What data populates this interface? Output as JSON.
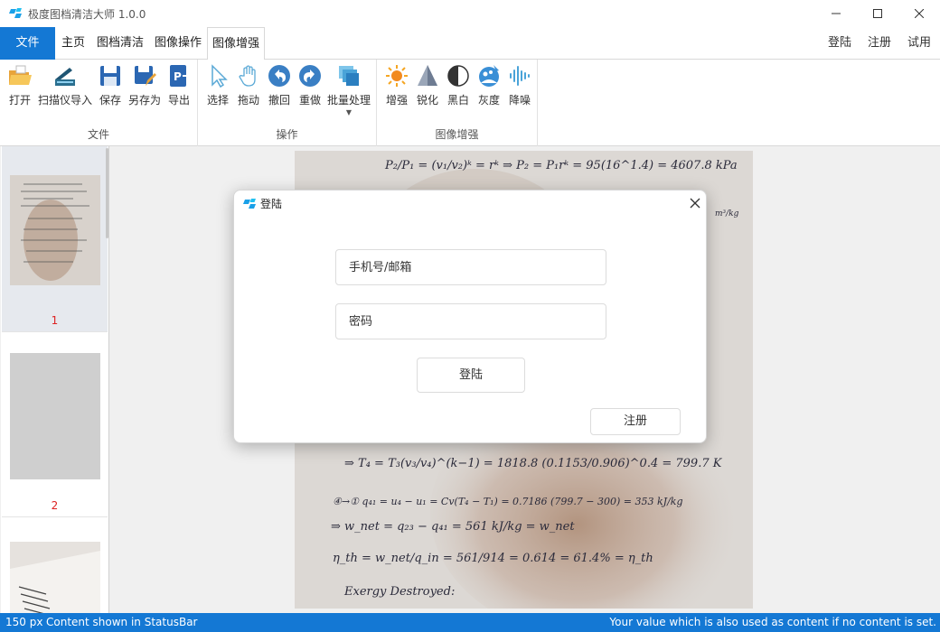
{
  "titlebar": {
    "title": "极度图档清洁大师 1.0.0",
    "minimize_icon": "minimize-icon",
    "maximize_icon": "maximize-icon",
    "close_icon": "close-icon"
  },
  "tabs": {
    "file": "文件",
    "items": [
      "主页",
      "图档清洁",
      "图像操作",
      "图像增强"
    ],
    "active": "图像增强",
    "right": [
      "登陆",
      "注册",
      "试用"
    ]
  },
  "ribbon": {
    "groups": [
      {
        "label": "文件",
        "buttons": [
          {
            "label": "打开",
            "icon": "folder-open-icon"
          },
          {
            "label": "扫描仪导入",
            "icon": "scanner-icon"
          },
          {
            "label": "保存",
            "icon": "save-icon"
          },
          {
            "label": "另存为",
            "icon": "save-as-icon"
          },
          {
            "label": "导出",
            "icon": "export-icon"
          }
        ]
      },
      {
        "label": "操作",
        "buttons": [
          {
            "label": "选择",
            "icon": "pointer-icon"
          },
          {
            "label": "拖动",
            "icon": "hand-icon"
          },
          {
            "label": "撤回",
            "icon": "undo-icon"
          },
          {
            "label": "重做",
            "icon": "redo-icon"
          },
          {
            "label": "批量处理",
            "icon": "batch-icon"
          }
        ]
      },
      {
        "label": "图像增强",
        "buttons": [
          {
            "label": "增强",
            "icon": "sun-icon"
          },
          {
            "label": "锐化",
            "icon": "triangle-icon"
          },
          {
            "label": "黑白",
            "icon": "contrast-icon"
          },
          {
            "label": "灰度",
            "icon": "grayscale-icon"
          },
          {
            "label": "降噪",
            "icon": "waveform-icon"
          }
        ]
      }
    ]
  },
  "thumbnails": [
    {
      "number": "1",
      "selected": true
    },
    {
      "number": "2",
      "selected": false
    },
    {
      "number": "",
      "selected": false
    }
  ],
  "dialog": {
    "title": "登陆",
    "phone_placeholder": "手机号/邮箱",
    "password_placeholder": "密码",
    "login_button": "登陆",
    "register_button": "注册"
  },
  "document": {
    "lines_top": [
      "P₂/P₁ = (v₁/v₂)ᵏ = rᵏ ⇒ P₂ = P₁rᵏ = 95(16^1.4) = 4607.8 kPa",
      "m³/kg"
    ],
    "lines_bottom": [
      "⇒ T₄ = T₃(v₃/v₄)^(k−1) = 1818.8 (0.1153/0.906)^0.4 = 799.7 K",
      "④→① q₄₁ = u₄ − u₁ = Cv(T₄ − T₁) = 0.7186 (799.7 − 300) = 353 kJ/kg",
      "⇒ w_net = q₂₃ − q₄₁ = 561 kJ/kg = w_net",
      "η_th = w_net/q_in = 561/914 = 0.614 = 61.4% = η_th",
      "Exergy Destroyed:"
    ]
  },
  "statusbar": {
    "zoom": "150 px",
    "left_text": "Content shown in StatusBar",
    "right_text": "Your value which is also used as content if no content is set."
  },
  "colors": {
    "accent": "#1478d4",
    "thumbnail_number": "#dd2222"
  }
}
